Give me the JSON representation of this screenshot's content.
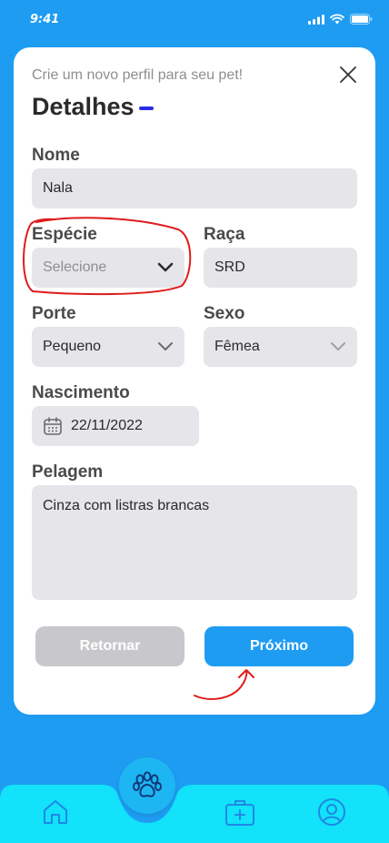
{
  "status": {
    "time": "9:41"
  },
  "header": {
    "subtitle": "Crie um novo perfil para seu pet!",
    "title": "Detalhes"
  },
  "form": {
    "nome": {
      "label": "Nome",
      "value": "Nala"
    },
    "especie": {
      "label": "Espécie",
      "placeholder": "Selecione"
    },
    "raca": {
      "label": "Raça",
      "value": "SRD"
    },
    "porte": {
      "label": "Porte",
      "value": "Pequeno"
    },
    "sexo": {
      "label": "Sexo",
      "value": "Fêmea"
    },
    "nascimento": {
      "label": "Nascimento",
      "value": "22/11/2022"
    },
    "pelagem": {
      "label": "Pelagem",
      "value": "Cinza com listras brancas"
    }
  },
  "actions": {
    "back_label": "Retornar",
    "next_label": "Próximo"
  },
  "colors": {
    "background": "#1E9CF2",
    "primary_button": "#1E9CF2",
    "disabled_button": "#C8C8CC",
    "tabbar": "#12E2FA",
    "annotation": "#E01B1B"
  },
  "tabbar": {
    "items": [
      "home-icon",
      "paw-icon",
      "medical-kit-icon",
      "profile-icon"
    ]
  }
}
